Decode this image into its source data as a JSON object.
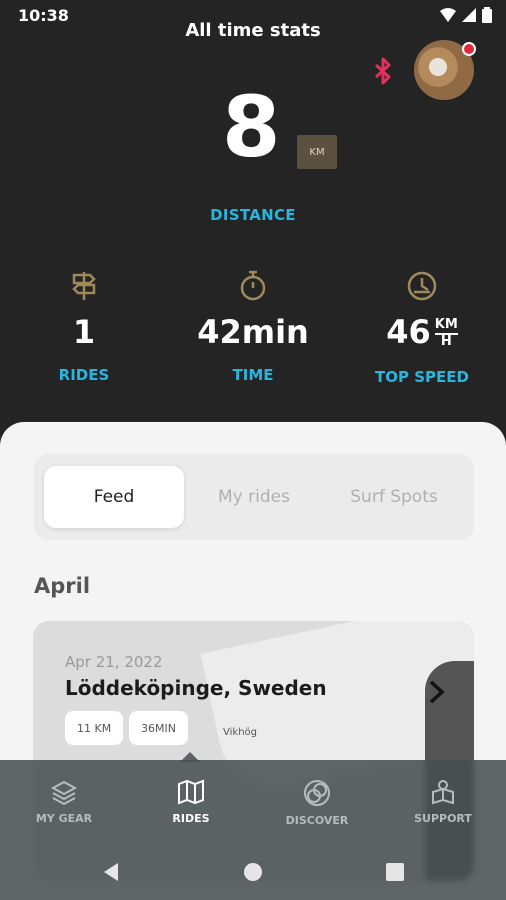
{
  "status": {
    "time": "10:38"
  },
  "header": {
    "title": "All time stats"
  },
  "hero": {
    "value": "8",
    "unit": "KM",
    "label": "DISTANCE"
  },
  "stats": [
    {
      "icon": "signpost-icon",
      "value": "1",
      "label": "RIDES"
    },
    {
      "icon": "stopwatch-icon",
      "value": "42min",
      "label": "TIME"
    },
    {
      "icon": "speedometer-icon",
      "value": "46",
      "unit_top": "KM",
      "unit_bottom": "H",
      "label": "TOP SPEED"
    }
  ],
  "tabs": [
    {
      "label": "Feed",
      "active": true
    },
    {
      "label": "My rides",
      "active": false
    },
    {
      "label": "Surf Spots",
      "active": false
    }
  ],
  "feed": {
    "month": "April",
    "card": {
      "date": "Apr 21, 2022",
      "place": "Löddeköpinge, Sweden",
      "distance": "11 KM",
      "duration": "36MIN",
      "map_label": "Vikhög"
    }
  },
  "bottom_nav": [
    {
      "icon": "layers-icon",
      "label": "MY GEAR",
      "active": false
    },
    {
      "icon": "map-icon",
      "label": "RIDES",
      "active": true
    },
    {
      "icon": "discover-icon",
      "label": "DISCOVER",
      "active": false
    },
    {
      "icon": "support-icon",
      "label": "SUPPORT",
      "active": false
    }
  ],
  "colors": {
    "accent": "#27b6e0",
    "background": "#242424",
    "icon_gold": "#a08a5c"
  }
}
